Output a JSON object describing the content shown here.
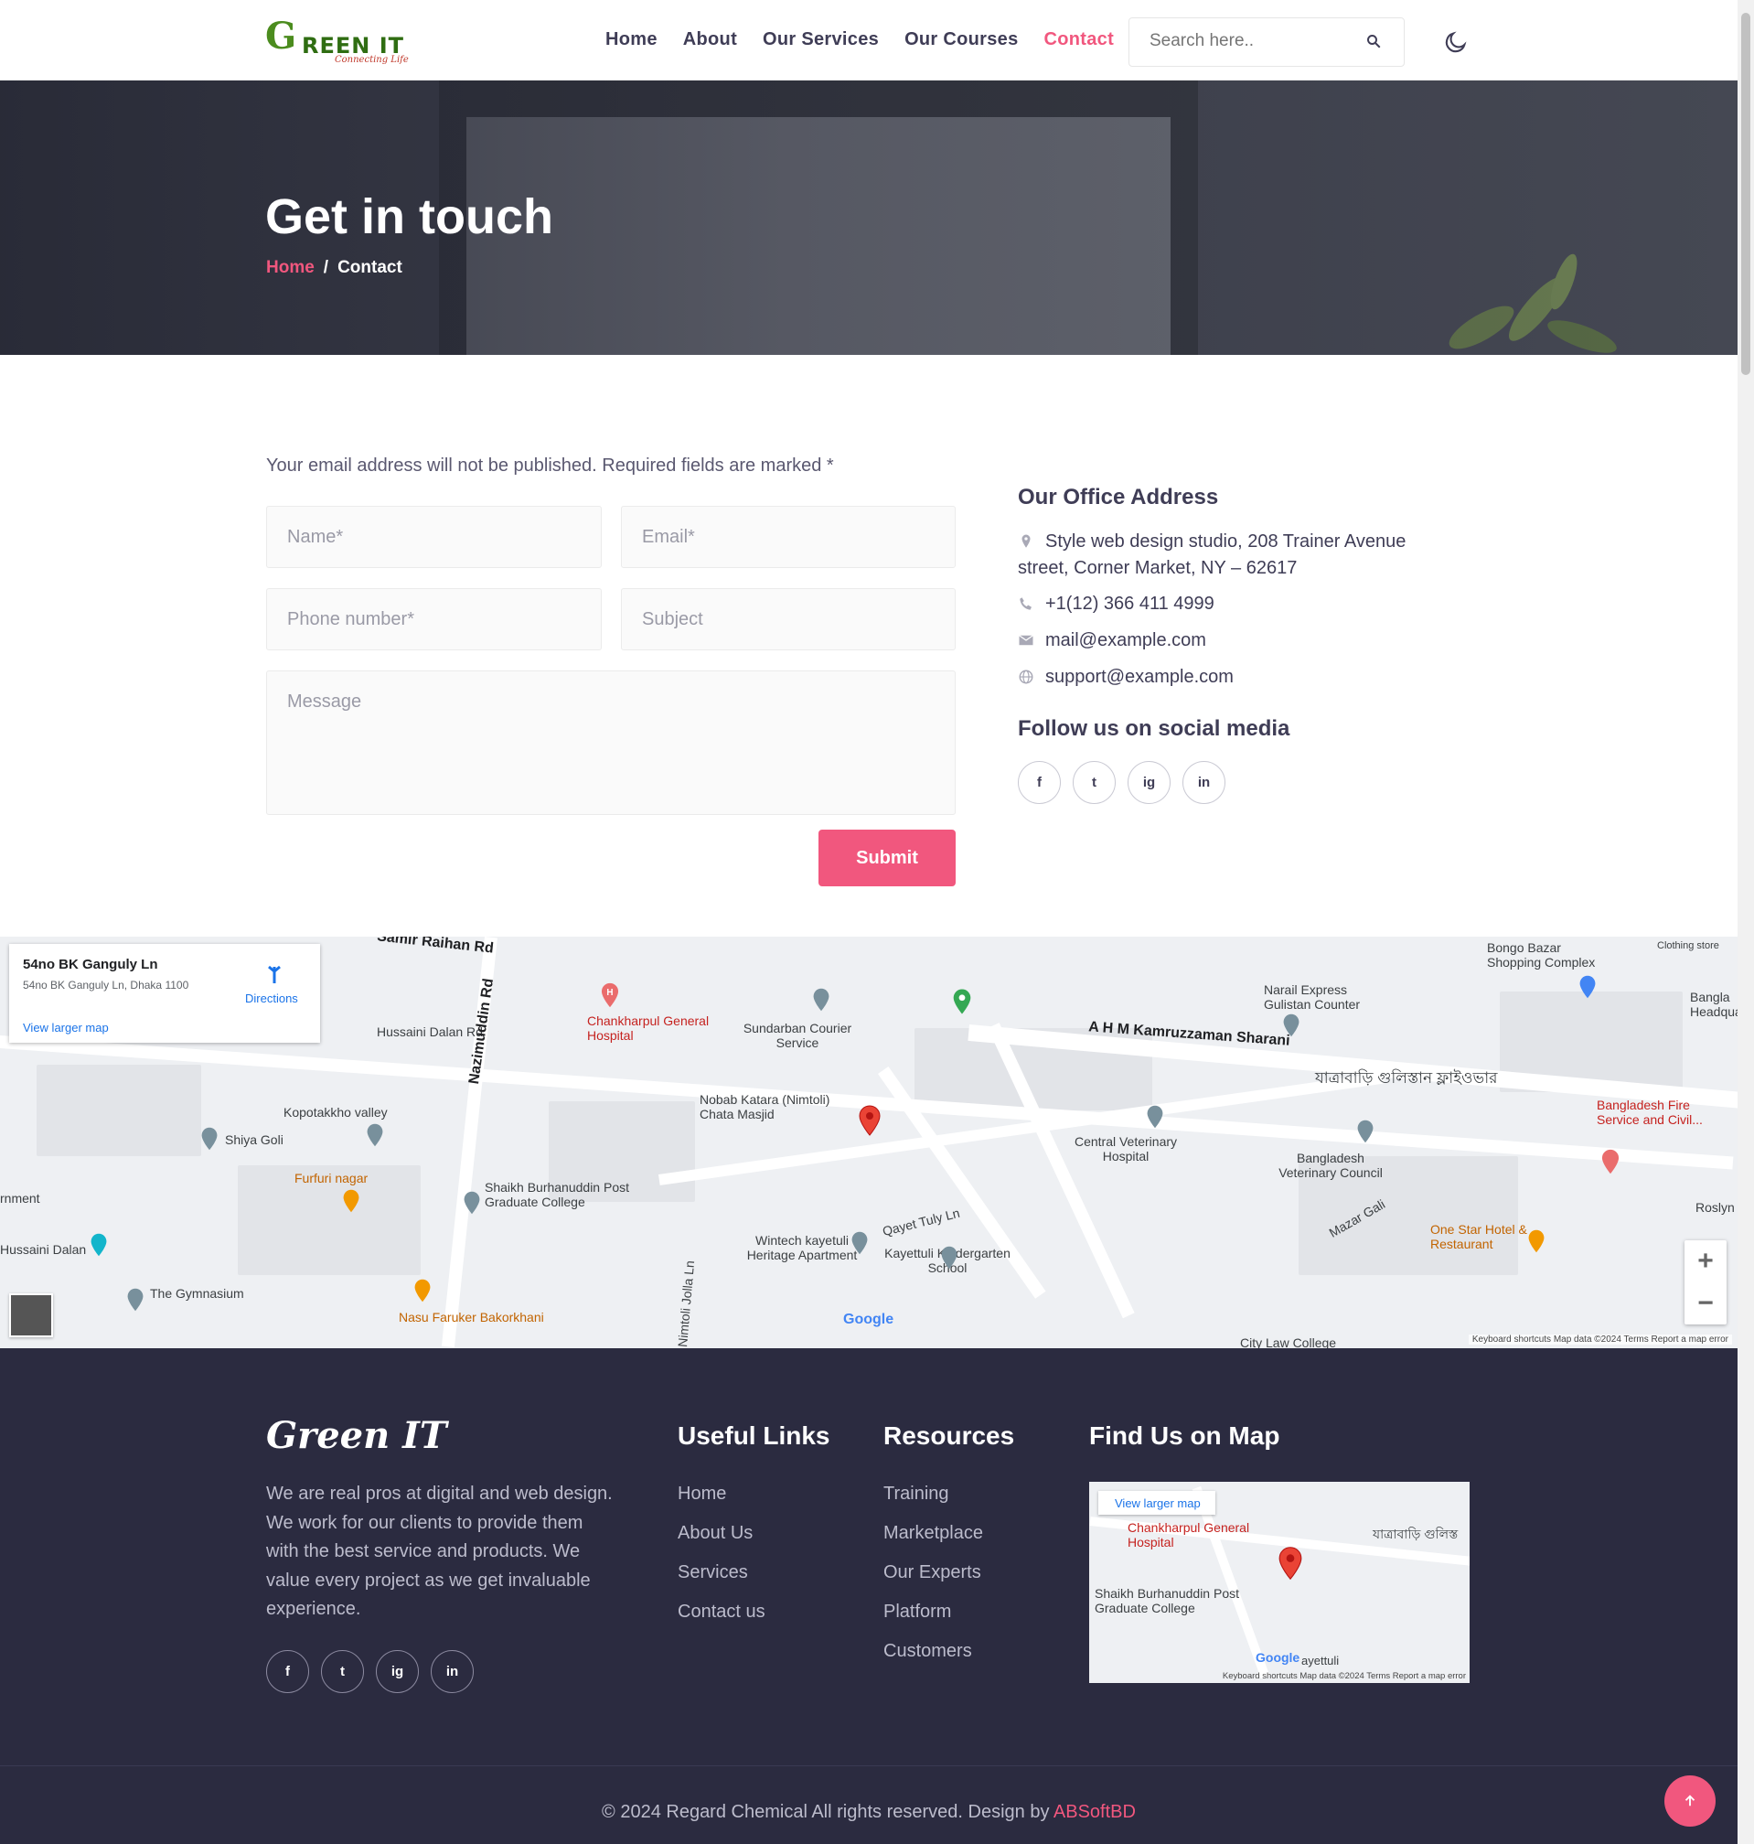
{
  "header": {
    "logo": {
      "letter": "G",
      "name": "REEN IT",
      "tagline": "Connecting Life"
    },
    "nav": [
      {
        "label": "Home",
        "active": false
      },
      {
        "label": "About",
        "active": false
      },
      {
        "label": "Our Services",
        "active": false
      },
      {
        "label": "Our Courses",
        "active": false
      },
      {
        "label": "Contact",
        "active": true
      }
    ],
    "search_placeholder": "Search here..",
    "icons": {
      "search": "search-icon",
      "theme": "moon-icon"
    }
  },
  "hero": {
    "title": "Get in touch",
    "breadcrumb": {
      "home": "Home",
      "separator": "/",
      "current": "Contact"
    }
  },
  "form": {
    "notice": "Your email address will not be published. Required fields are marked *",
    "name_placeholder": "Name*",
    "email_placeholder": "Email*",
    "phone_placeholder": "Phone number*",
    "subject_placeholder": "Subject",
    "message_placeholder": "Message",
    "submit_label": "Submit"
  },
  "office": {
    "title": "Our Office Address",
    "address_line1": "Style web design studio, 208 Trainer Avenue",
    "address_line2": "street, Corner Market, NY – 62617",
    "phone": "+1(12) 366 411 4999",
    "email": "mail@example.com",
    "support": "support@example.com",
    "follow_title": "Follow us on social media",
    "social": [
      "f",
      "t",
      "ig",
      "in"
    ]
  },
  "map": {
    "card_title": "54no BK Ganguly Ln",
    "card_address": "54no BK Ganguly Ln, Dhaka 1100",
    "card_link": "View larger map",
    "card_directions": "Directions",
    "labels": {
      "raihan": "Samir Raihan Rd",
      "husaini": "Hussaini Dalan Rd",
      "nazimuddin": "Nazimuddin Rd",
      "chankharpul": "Chankharpul General Hospital",
      "sundarban": "Sundarban Courier Service",
      "kamruzzaman": "A H M Kamruzzaman Sharani",
      "narail": "Narail Express Gulistan Counter",
      "bongo": "Bongo Bazar Shopping Complex",
      "clothing": "Clothing store",
      "bangla_hq": "Bangla Headquar",
      "kopotakkho": "Kopotakkho valley",
      "shiya": "Shiya Goli",
      "nobab": "Nobab Katara (Nimtoli) Chata Masjid",
      "central_vet": "Central Veterinary Hospital",
      "bd_vet": "Bangladesh Veterinary Council",
      "fire": "Bangladesh Fire Service and Civil...",
      "furfuri": "Furfuri nagar",
      "shaikh": "Shaikh Burhanuddin Post Graduate College",
      "ernment": "rnment",
      "wintech": "Wintech kayetuli Heritage Apartment",
      "qayet": "Qayet Tuly Ln",
      "kayettuli": "Kayettuli Kindergarten School",
      "mazar": "Mazar Gali",
      "onestar": "One Star Hotel & Restaurant",
      "roslyn": "Roslyn",
      "husaini_dalan": "Hussaini Dalan",
      "gymnasium": "The Gymnasium",
      "nasu": "Nasu Faruker Bakorkhani",
      "jolla": "Nimtoli Jolla Ln",
      "city_law": "City Law College",
      "flyover": "যাত্রাবাড়ি গুলিস্তান ফ্লাইওভার"
    },
    "google": "Google",
    "attribution": "Keyboard shortcuts   Map data ©2024   Terms   Report a map error",
    "zoom_in": "+",
    "zoom_out": "−"
  },
  "footer": {
    "brand": "Green IT",
    "about": "We are real pros at digital and web design. We work for our clients to provide them with the best service and products. We value every project as we get invaluable experience.",
    "useful_title": "Useful Links",
    "useful_links": [
      "Home",
      "About Us",
      "Services",
      "Contact us"
    ],
    "resources_title": "Resources",
    "resources": [
      "Training",
      "Marketplace",
      "Our Experts",
      "Platform",
      "Customers"
    ],
    "map_title": "Find Us on Map",
    "mini_map": {
      "link": "View larger map",
      "chankharpul": "Chankharpul General Hospital",
      "shaikh": "Shaikh Burhanuddin Post Graduate College",
      "flyover": "যাত্রাবাড়ি গুলিস্ত",
      "kayettuli": "ayettuli",
      "google": "Google",
      "attribution": "Keyboard shortcuts   Map data ©2024   Terms   Report a map error"
    },
    "copyright": "© 2024 Regard Chemical All rights reserved. Design by",
    "designer": "ABSoftBD"
  },
  "colors": {
    "accent": "#f1577e",
    "text": "#3f3d56",
    "footer_bg": "#2b2b40",
    "logo_green": "#4b8c1e"
  }
}
